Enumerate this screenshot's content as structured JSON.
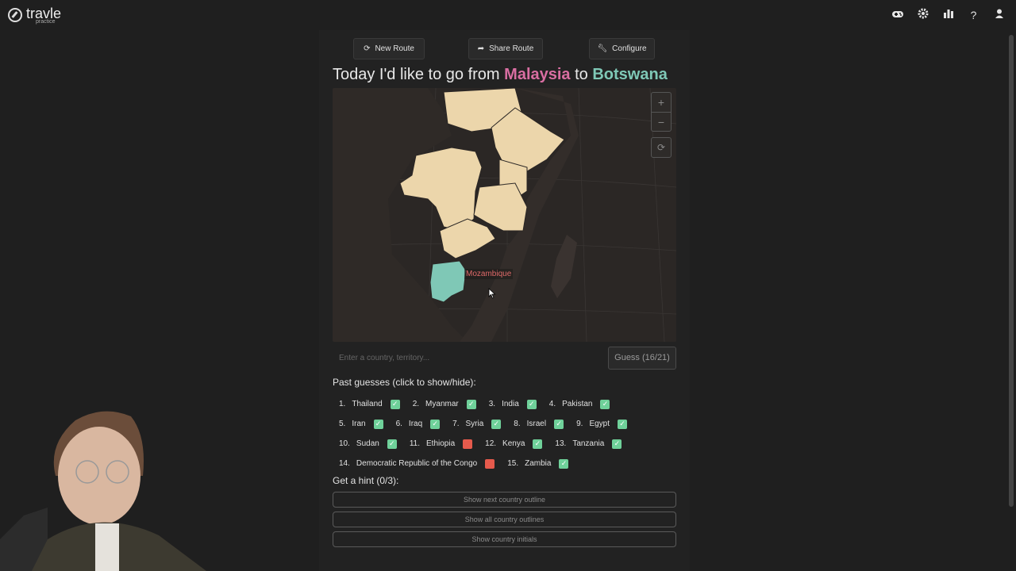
{
  "app": {
    "name": "travle",
    "subtitle": "practice"
  },
  "topbar_icons": [
    "gamepad-icon",
    "gear-icon",
    "bar-chart-icon",
    "help-icon",
    "user-icon"
  ],
  "buttons": {
    "new_route": "New Route",
    "share_route": "Share Route",
    "configure": "Configure"
  },
  "headline": {
    "prefix": "Today I'd like to go from",
    "from": "Malaysia",
    "mid": "to",
    "to": "Botswana"
  },
  "map": {
    "tooltip": "Mozambique",
    "zoom_in": "+",
    "zoom_out": "−",
    "reset": "⟳"
  },
  "input": {
    "placeholder": "Enter a country, territory..."
  },
  "guess_button": "Guess (16/21)",
  "past_guesses_title": "Past guesses (click to show/hide):",
  "guesses": [
    {
      "n": "1.",
      "name": "Thailand",
      "status": "ok"
    },
    {
      "n": "2.",
      "name": "Myanmar",
      "status": "ok"
    },
    {
      "n": "3.",
      "name": "India",
      "status": "ok"
    },
    {
      "n": "4.",
      "name": "Pakistan",
      "status": "ok"
    },
    {
      "n": "5.",
      "name": "Iran",
      "status": "ok"
    },
    {
      "n": "6.",
      "name": "Iraq",
      "status": "ok"
    },
    {
      "n": "7.",
      "name": "Syria",
      "status": "ok"
    },
    {
      "n": "8.",
      "name": "Israel",
      "status": "ok"
    },
    {
      "n": "9.",
      "name": "Egypt",
      "status": "ok"
    },
    {
      "n": "10.",
      "name": "Sudan",
      "status": "ok"
    },
    {
      "n": "11.",
      "name": "Ethiopia",
      "status": "bad"
    },
    {
      "n": "12.",
      "name": "Kenya",
      "status": "ok"
    },
    {
      "n": "13.",
      "name": "Tanzania",
      "status": "ok"
    },
    {
      "n": "14.",
      "name": "Democratic Republic of the Congo",
      "status": "bad"
    },
    {
      "n": "15.",
      "name": "Zambia",
      "status": "ok"
    }
  ],
  "hint_title": "Get a hint (0/3):",
  "hints": [
    "Show next country outline",
    "Show all country outlines",
    "Show country initials"
  ],
  "colors": {
    "guessed_country": "#ecd6ab",
    "target_country": "#7fc8b6",
    "from_color": "#d96ea2",
    "correct": "#6fd19a",
    "incorrect": "#e65a4c"
  }
}
